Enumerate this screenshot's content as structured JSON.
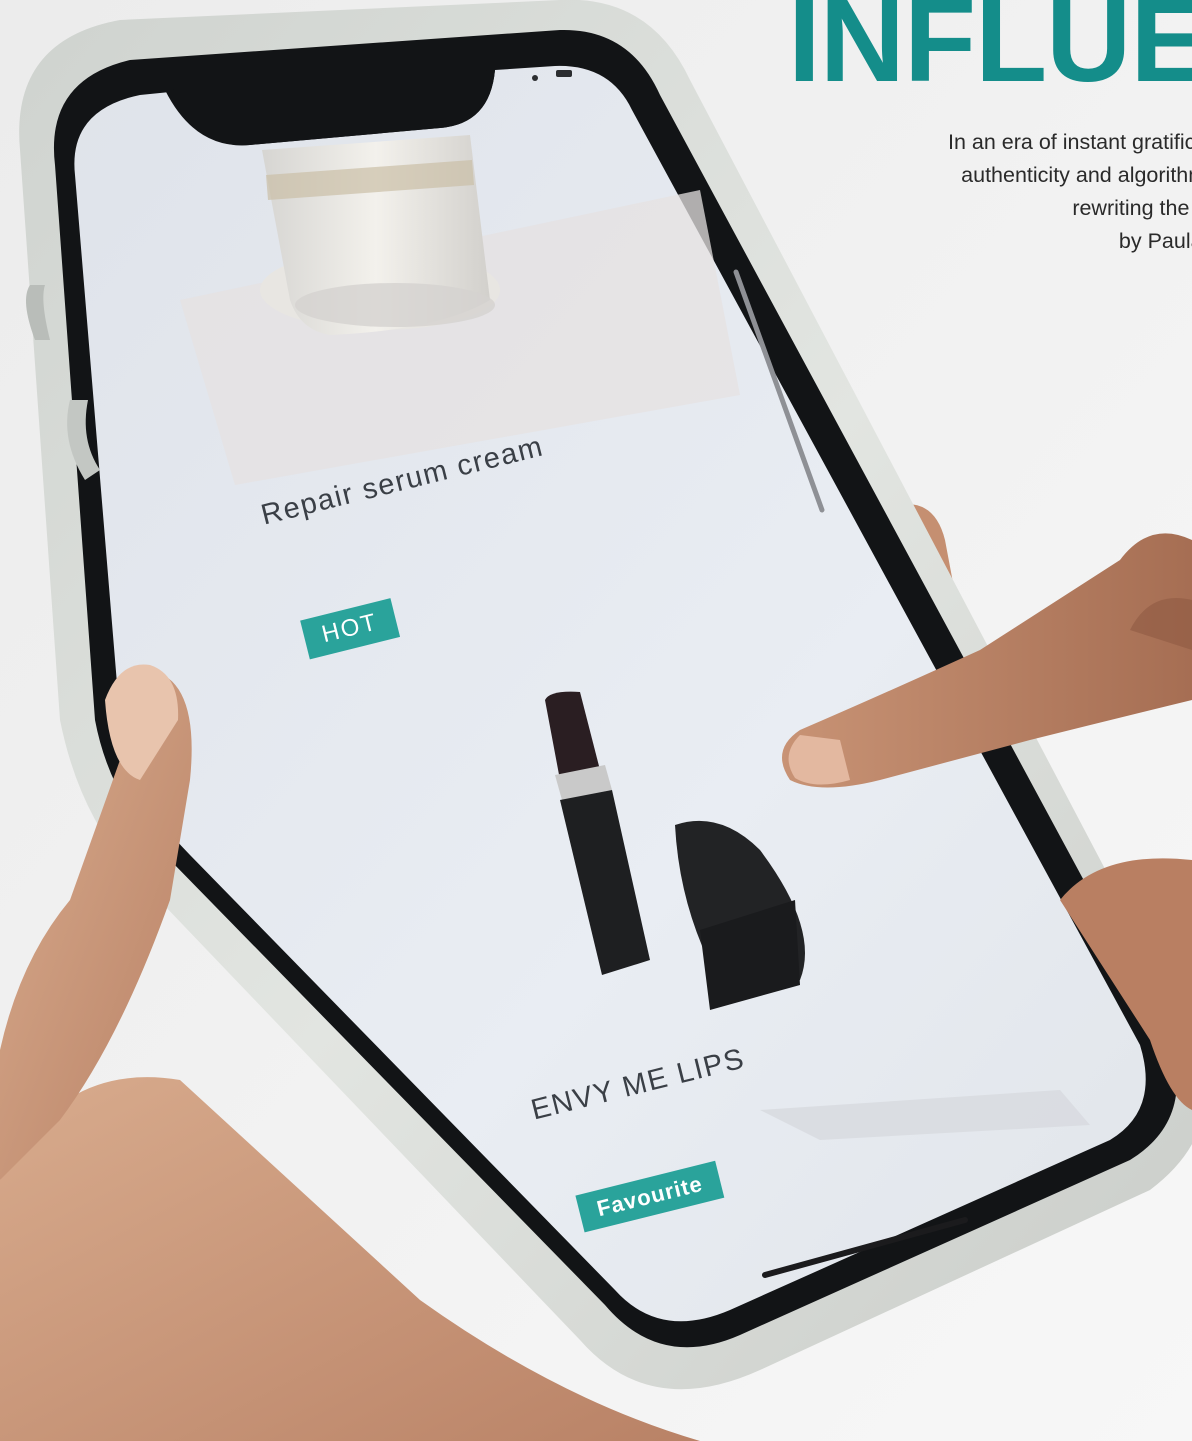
{
  "headline": {
    "title": "INFLUE",
    "subtitle_lines": [
      "In an era of instant gratification",
      "authenticity and algorithms ar",
      "rewriting the rules",
      "by Paula Jus"
    ]
  },
  "phone_screen": {
    "products": [
      {
        "name": "Repair serum cream",
        "tag": "HOT"
      },
      {
        "name": "ENVY ME LIPS",
        "tag": "Favourite"
      }
    ]
  },
  "colors": {
    "accent_teal": "#148d8a",
    "tag_teal": "#2aa39b",
    "background": "#f1f1f1",
    "phone_case": "#d9dcd8",
    "screen": "#e4e8ee"
  }
}
